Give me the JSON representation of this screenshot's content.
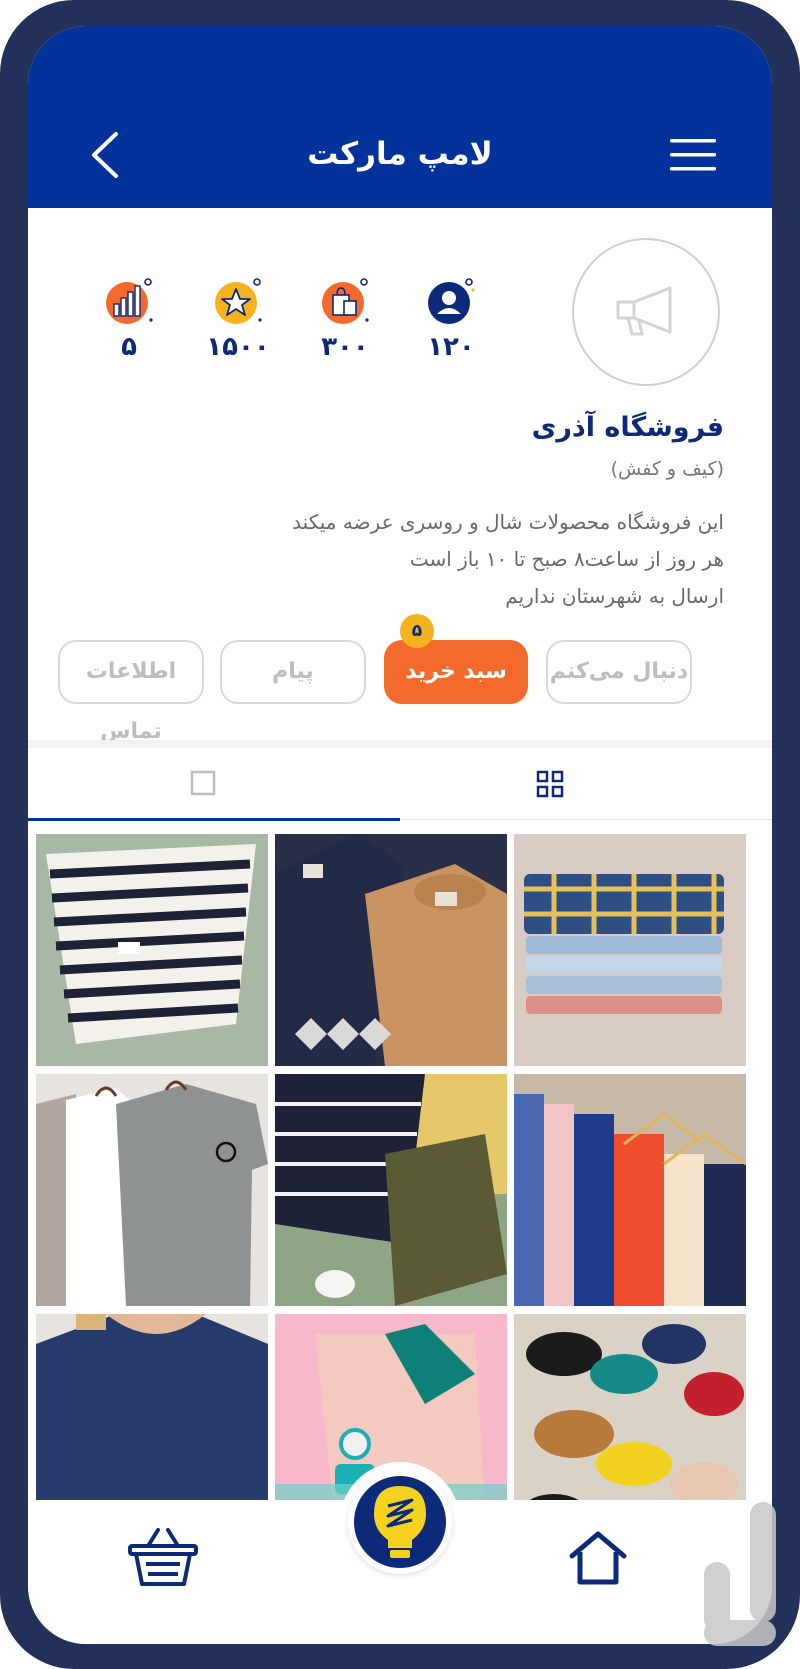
{
  "header": {
    "title": "لامپ مارکت",
    "back_icon": "chevron-left-icon",
    "menu_icon": "hamburger-menu-icon"
  },
  "colors": {
    "brand_blue": "#03329a",
    "navy_text": "#0d2a7a",
    "accent_orange": "#f46a2c",
    "badge_yellow": "#f5b21f",
    "frame": "#23315a"
  },
  "profile": {
    "name": "فروشگاه آذری",
    "category": "(کیف و کفش)",
    "description": [
      "این فروشگاه محصولات شال و روسری عرضه میکند",
      "هر روز از ساعت۸ صبح تا ۱۰ باز است",
      "ارسال به شهرستان نداریم"
    ],
    "avatar_icon": "megaphone-icon"
  },
  "stats": [
    {
      "icon": "followers-icon",
      "value": "۱۲۰"
    },
    {
      "icon": "shopping-bag-icon",
      "value": "۳۰۰"
    },
    {
      "icon": "star-rating-icon",
      "value": "۱۵۰۰"
    },
    {
      "icon": "bar-chart-icon",
      "value": "۵"
    }
  ],
  "actions": {
    "follow": "دنبال می‌کنم",
    "cart": "سبد خرید",
    "cart_count": "۵",
    "message": "پیام",
    "contact": "اطلاعات تماس"
  },
  "tabs": [
    {
      "icon": "grid-view-icon",
      "active": true
    },
    {
      "icon": "single-view-icon",
      "active": false
    }
  ],
  "products": [
    "plaid-shirts-photo",
    "sweaters-photo",
    "striped-tee-photo",
    "hanging-clothes-photo",
    "polo-shorts-photo",
    "gray-tshirts-photo",
    "loafers-photo",
    "pink-polo-watch-photo",
    "navy-top-photo"
  ],
  "bottom_nav": {
    "home_icon": "home-icon",
    "center_icon": "lamp-logo-icon",
    "basket_icon": "shopping-basket-icon"
  }
}
